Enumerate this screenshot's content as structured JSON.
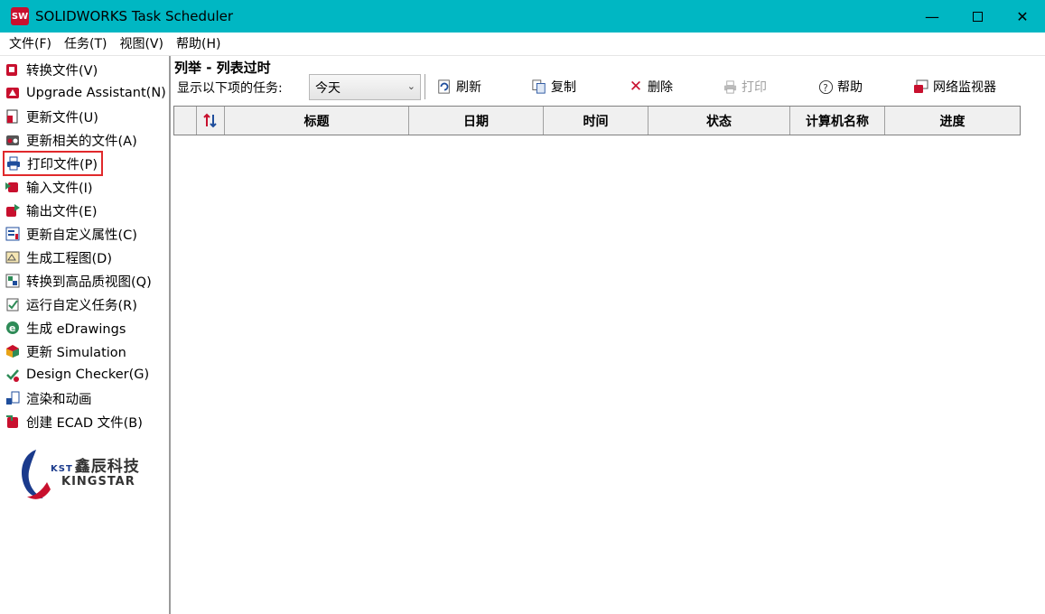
{
  "window": {
    "title": "SOLIDWORKS Task Scheduler",
    "minimize": "—",
    "maximize": "☐",
    "close": "✕",
    "app_icon": "solidworks-logo"
  },
  "menu": [
    "文件(F)",
    "任务(T)",
    "视图(V)",
    "帮助(H)"
  ],
  "sidebar": {
    "items": [
      {
        "label": "转换文件(V)",
        "icon": "convert-file-icon"
      },
      {
        "label": "Upgrade Assistant(N)",
        "icon": "upgrade-assistant-icon"
      },
      {
        "label": "更新文件(U)",
        "icon": "update-file-icon"
      },
      {
        "label": "更新相关的文件(A)",
        "icon": "update-related-files-icon"
      },
      {
        "label": "打印文件(P)",
        "icon": "print-file-icon",
        "selected": true
      },
      {
        "label": "输入文件(I)",
        "icon": "import-file-icon"
      },
      {
        "label": "输出文件(E)",
        "icon": "export-file-icon"
      },
      {
        "label": "更新自定义属性(C)",
        "icon": "custom-properties-icon"
      },
      {
        "label": "生成工程图(D)",
        "icon": "drawing-icon"
      },
      {
        "label": "转换到高品质视图(Q)",
        "icon": "high-quality-view-icon"
      },
      {
        "label": "运行自定义任务(R)",
        "icon": "custom-task-icon"
      },
      {
        "label": "生成 eDrawings",
        "icon": "edrawings-icon"
      },
      {
        "label": "更新 Simulation",
        "icon": "simulation-icon"
      },
      {
        "label": "Design Checker(G)",
        "icon": "design-checker-icon"
      },
      {
        "label": "渲染和动画",
        "icon": "render-animation-icon"
      },
      {
        "label": "创建 ECAD 文件(B)",
        "icon": "ecad-file-icon"
      }
    ],
    "logo": {
      "kst": "KST",
      "cn": "鑫辰科技",
      "en": "KINGSTAR"
    }
  },
  "panel": {
    "title": "列举 - 列表过时",
    "show_label": "显示以下项的任务:",
    "filter_value": "今天",
    "toolbar": {
      "refresh": "刷新",
      "copy": "复制",
      "delete": "删除",
      "print": "打印",
      "help": "帮助",
      "network_monitor": "网络监视器"
    },
    "columns": [
      "",
      "",
      "标题",
      "日期",
      "时间",
      "状态",
      "计算机名称",
      "进度"
    ]
  },
  "colors": {
    "titlebar": "#00b7c3",
    "selected_border": "#e0292b"
  }
}
